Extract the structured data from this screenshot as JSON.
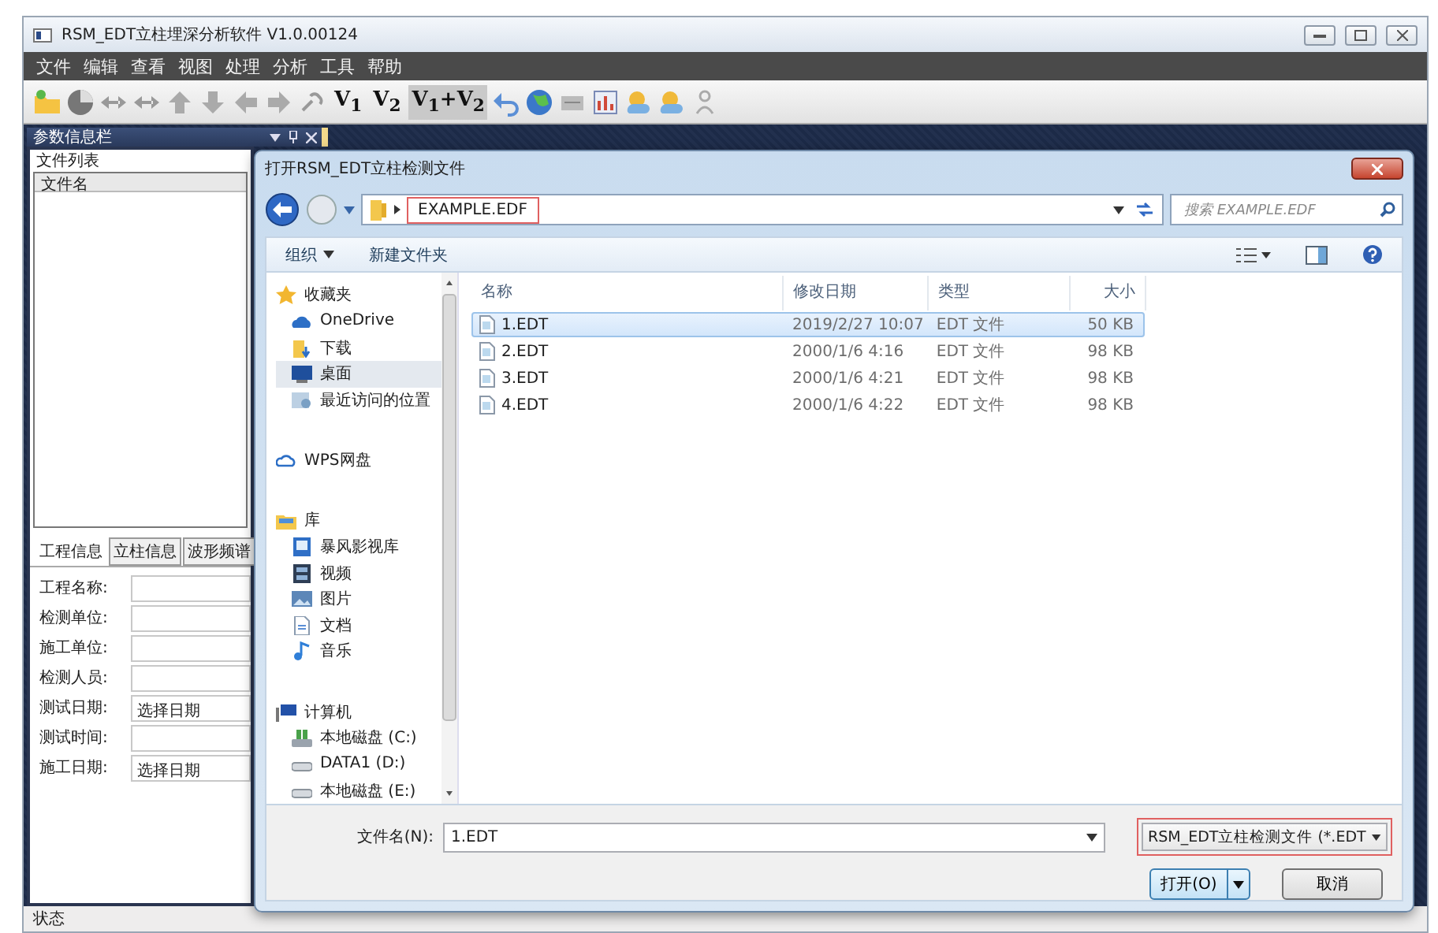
{
  "window": {
    "title": "RSM_EDT立柱埋深分析软件 V1.0.00124"
  },
  "menu": [
    "文件",
    "编辑",
    "查看",
    "视图",
    "处理",
    "分析",
    "工具",
    "帮助"
  ],
  "toolbar": {
    "text_buttons": [
      "V$_{1}$",
      "V$_{2}$",
      "V$_{1}$+V$_{2}$"
    ]
  },
  "side_panel": {
    "title": "参数信息栏",
    "file_list": {
      "legend": "文件列表",
      "column": "文件名"
    },
    "tabs": [
      {
        "label": "工程信息",
        "selected": true
      },
      {
        "label": "立柱信息",
        "selected": false
      },
      {
        "label": "波形频谱",
        "selected": false
      }
    ],
    "fields": [
      {
        "label": "工程名称:"
      },
      {
        "label": "检测单位:"
      },
      {
        "label": "施工单位:"
      },
      {
        "label": "检测人员:"
      },
      {
        "label": "测试日期:",
        "value": "选择日期"
      },
      {
        "label": "测试时间:"
      },
      {
        "label": "施工日期:",
        "value": "选择日期"
      }
    ]
  },
  "status_bar": "状态",
  "dialog": {
    "title": "打开RSM_EDT立柱检测文件",
    "path": {
      "text": "EXAMPLE.EDF",
      "highlighted": true
    },
    "search_placeholder": "搜索 EXAMPLE.EDF",
    "organize": "组织",
    "new_folder": "新建文件夹",
    "nav": [
      {
        "label": "收藏夹",
        "kind": "star",
        "selected": false,
        "children": [
          {
            "label": "OneDrive",
            "kind": "cloud",
            "selected": false
          },
          {
            "label": "下载",
            "kind": "download",
            "selected": false
          },
          {
            "label": "桌面",
            "kind": "desktop",
            "selected": true
          },
          {
            "label": "最近访问的位置",
            "kind": "recent",
            "selected": false
          }
        ]
      },
      {
        "label": "WPS网盘",
        "kind": "cloud-outline",
        "selected": false
      },
      {
        "label": "库",
        "kind": "library",
        "selected": false,
        "children": [
          {
            "label": "暴风影视库",
            "kind": "media",
            "selected": false
          },
          {
            "label": "视频",
            "kind": "video",
            "selected": false
          },
          {
            "label": "图片",
            "kind": "image",
            "selected": false
          },
          {
            "label": "文档",
            "kind": "document",
            "selected": false
          },
          {
            "label": "音乐",
            "kind": "music",
            "selected": false
          }
        ]
      },
      {
        "label": "计算机",
        "kind": "computer",
        "selected": false,
        "children": [
          {
            "label": "本地磁盘 (C:)",
            "kind": "system-disk",
            "selected": false
          },
          {
            "label": "DATA1 (D:)",
            "kind": "disk",
            "selected": false
          },
          {
            "label": "本地磁盘 (E:)",
            "kind": "disk",
            "selected": false
          }
        ]
      }
    ],
    "columns": [
      "名称",
      "修改日期",
      "类型",
      "大小"
    ],
    "files": [
      {
        "name": "1.EDT",
        "date": "2019/2/27 10:07",
        "type": "EDT 文件",
        "size": "50 KB",
        "selected": true
      },
      {
        "name": "2.EDT",
        "date": "2000/1/6 4:16",
        "type": "EDT 文件",
        "size": "98 KB",
        "selected": false
      },
      {
        "name": "3.EDT",
        "date": "2000/1/6 4:21",
        "type": "EDT 文件",
        "size": "98 KB",
        "selected": false
      },
      {
        "name": "4.EDT",
        "date": "2000/1/6 4:22",
        "type": "EDT 文件",
        "size": "98 KB",
        "selected": false
      }
    ],
    "filename_label": "文件名(N):",
    "filename": "1.EDT",
    "filter": {
      "text": "RSM_EDT立柱检测文件 (*.EDT",
      "highlighted": true
    },
    "open": "打开(O)",
    "cancel": "取消"
  }
}
